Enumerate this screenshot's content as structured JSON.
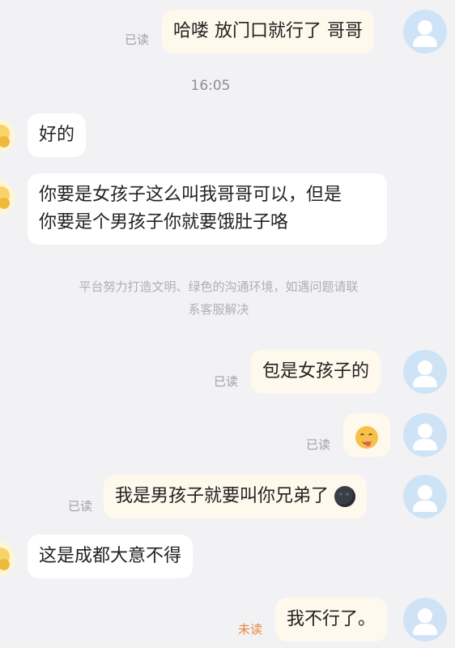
{
  "chat": {
    "time_divider": "16:05",
    "notice_line1": "平台努力打造文明、绿色的沟通环境，如遇问题请联",
    "notice_line2": "系客服解决",
    "messages": [
      {
        "side": "self",
        "text": "哈喽 放门口就行了 哥哥",
        "status": "已读"
      },
      {
        "side": "other",
        "text": "好的"
      },
      {
        "side": "other",
        "line1": "你要是女孩子这么叫我哥哥可以，但是",
        "line2": "你要是个男孩子你就要饿肚子咯"
      },
      {
        "side": "self",
        "text": "包是女孩子的",
        "status": "已读"
      },
      {
        "side": "self",
        "emoji": "smiling-face-with-tongue",
        "status": "已读"
      },
      {
        "side": "self",
        "text": "我是男孩子就要叫你兄弟了",
        "emoji": "new-moon-face",
        "status": "已读"
      },
      {
        "side": "other",
        "text": "这是成都大意不得"
      },
      {
        "side": "self",
        "text": "我不行了。",
        "status": "未读"
      }
    ]
  },
  "colors": {
    "background": "#f2f2f4",
    "self_bubble": "#fff8ec",
    "other_bubble": "#ffffff",
    "read": "#a0a0a6",
    "unread": "#e8863c"
  }
}
